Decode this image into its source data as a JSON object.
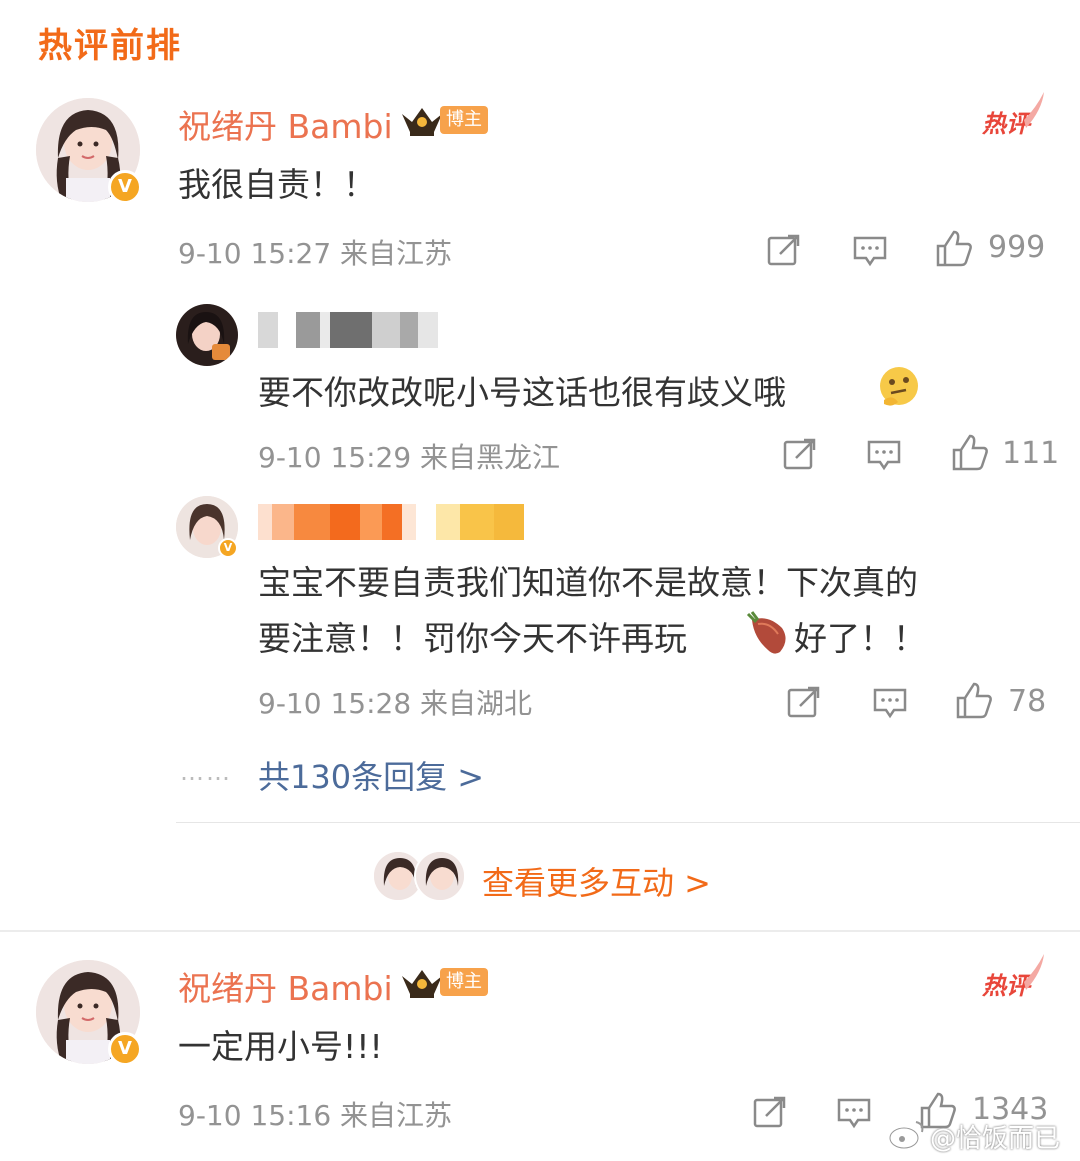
{
  "section_title": "热评前排",
  "comments": [
    {
      "author": "祝绪丹 Bambi",
      "badge": "博主",
      "hot_label": "热评",
      "text": "我很自责！！",
      "meta": "9-10 15:27 来自江苏",
      "likes": "999",
      "replies": [
        {
          "author_hidden": true,
          "text": "要不你改改呢小号这话也很有歧义哦",
          "emoji": "thinking-face-emoji",
          "meta": "9-10 15:29 来自黑龙江",
          "likes": "111"
        },
        {
          "author_hidden": true,
          "text_line1": "宝宝不要自责我们知道你不是故意！下次真的",
          "text_line2a": "要注意！！罚你今天不许再玩",
          "text_line2b": "好了！！",
          "emoji": "sweet-potato-emoji",
          "meta": "9-10 15:28 来自湖北",
          "likes": "78"
        }
      ],
      "reply_total": "共130条回复 >",
      "reply_dots": "……"
    },
    {
      "author": "祝绪丹 Bambi",
      "badge": "博主",
      "hot_label": "热评",
      "text": "一定用小号!!!",
      "meta": "9-10 15:16 来自江苏",
      "likes": "1343"
    }
  ],
  "more_interactions": "查看更多互动 >",
  "watermark": "@恰饭而已",
  "colors": {
    "accent_orange": "#f26a18",
    "name_orange": "#eb7350",
    "link_blue": "#4c6b9a",
    "meta_gray": "#939393",
    "hot_red": "#e8463a"
  }
}
